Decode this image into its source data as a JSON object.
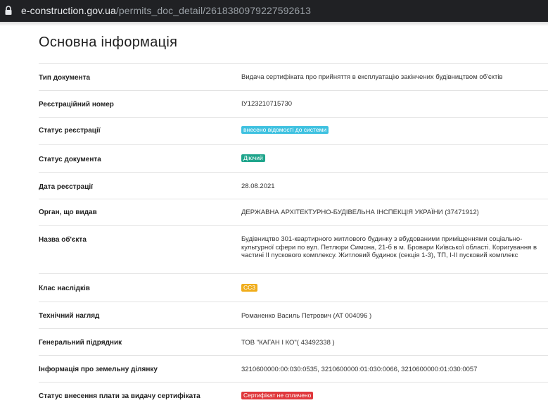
{
  "browser": {
    "url_host": "e-construction.gov.ua",
    "url_path": "/permits_doc_detail/2618380979227592613"
  },
  "page": {
    "title": "Основна інформація"
  },
  "rows": [
    {
      "label": "Тип документа",
      "value": "Видача сертифіката про прийняття в експлуатацію закінчених будівництвом об'єктів"
    },
    {
      "label": "Реєстраційний номер",
      "value": "ІУ123210715730"
    },
    {
      "label": "Статус реєстрації",
      "badge": "внесено відомості до системи",
      "badge_color": "#3ec1e0"
    },
    {
      "label": "Статус документа",
      "badge": "Діючий",
      "badge_color": "#1fa58c"
    },
    {
      "label": "Дата реєстрації",
      "value": "28.08.2021"
    },
    {
      "label": "Орган, що видав",
      "value": "ДЕРЖАВНА АРХІТЕКТУРНО-БУДІВЕЛЬНА ІНСПЕКЦІЯ УКРАЇНИ (37471912)"
    },
    {
      "label": "Назва об'єкта",
      "value": "Будівництво 301-квартирного житлового будинку з вбудованими приміщеннями соціально-культурної сфери по вул. Петлюри Симона, 21-б в м. Бровари Київської області. Коригування в частині ІІ пускового комплексу. Житловий будинок (секція 1-3), ТП, І-ІІ пусковий комплекс"
    },
    {
      "label": "Клас наслідків",
      "badge": "СС3",
      "badge_color": "#f0ad1c"
    },
    {
      "label": "Технічний нагляд",
      "value": "Романенко Василь Петрович (АТ 004096 )"
    },
    {
      "label": "Генеральний підрядник",
      "value": "ТОВ \"КАГАН І КО\"( 43492338 )"
    },
    {
      "label": "Інформація про земельну ділянку",
      "value": "3210600000:00:030:0535, 3210600000:01:030:0066, 3210600000:01:030:0057"
    },
    {
      "label": "Статус внесення плати за видачу сертифіката",
      "badge": "Сертифікат не сплачено",
      "badge_color": "#e0383c"
    }
  ]
}
